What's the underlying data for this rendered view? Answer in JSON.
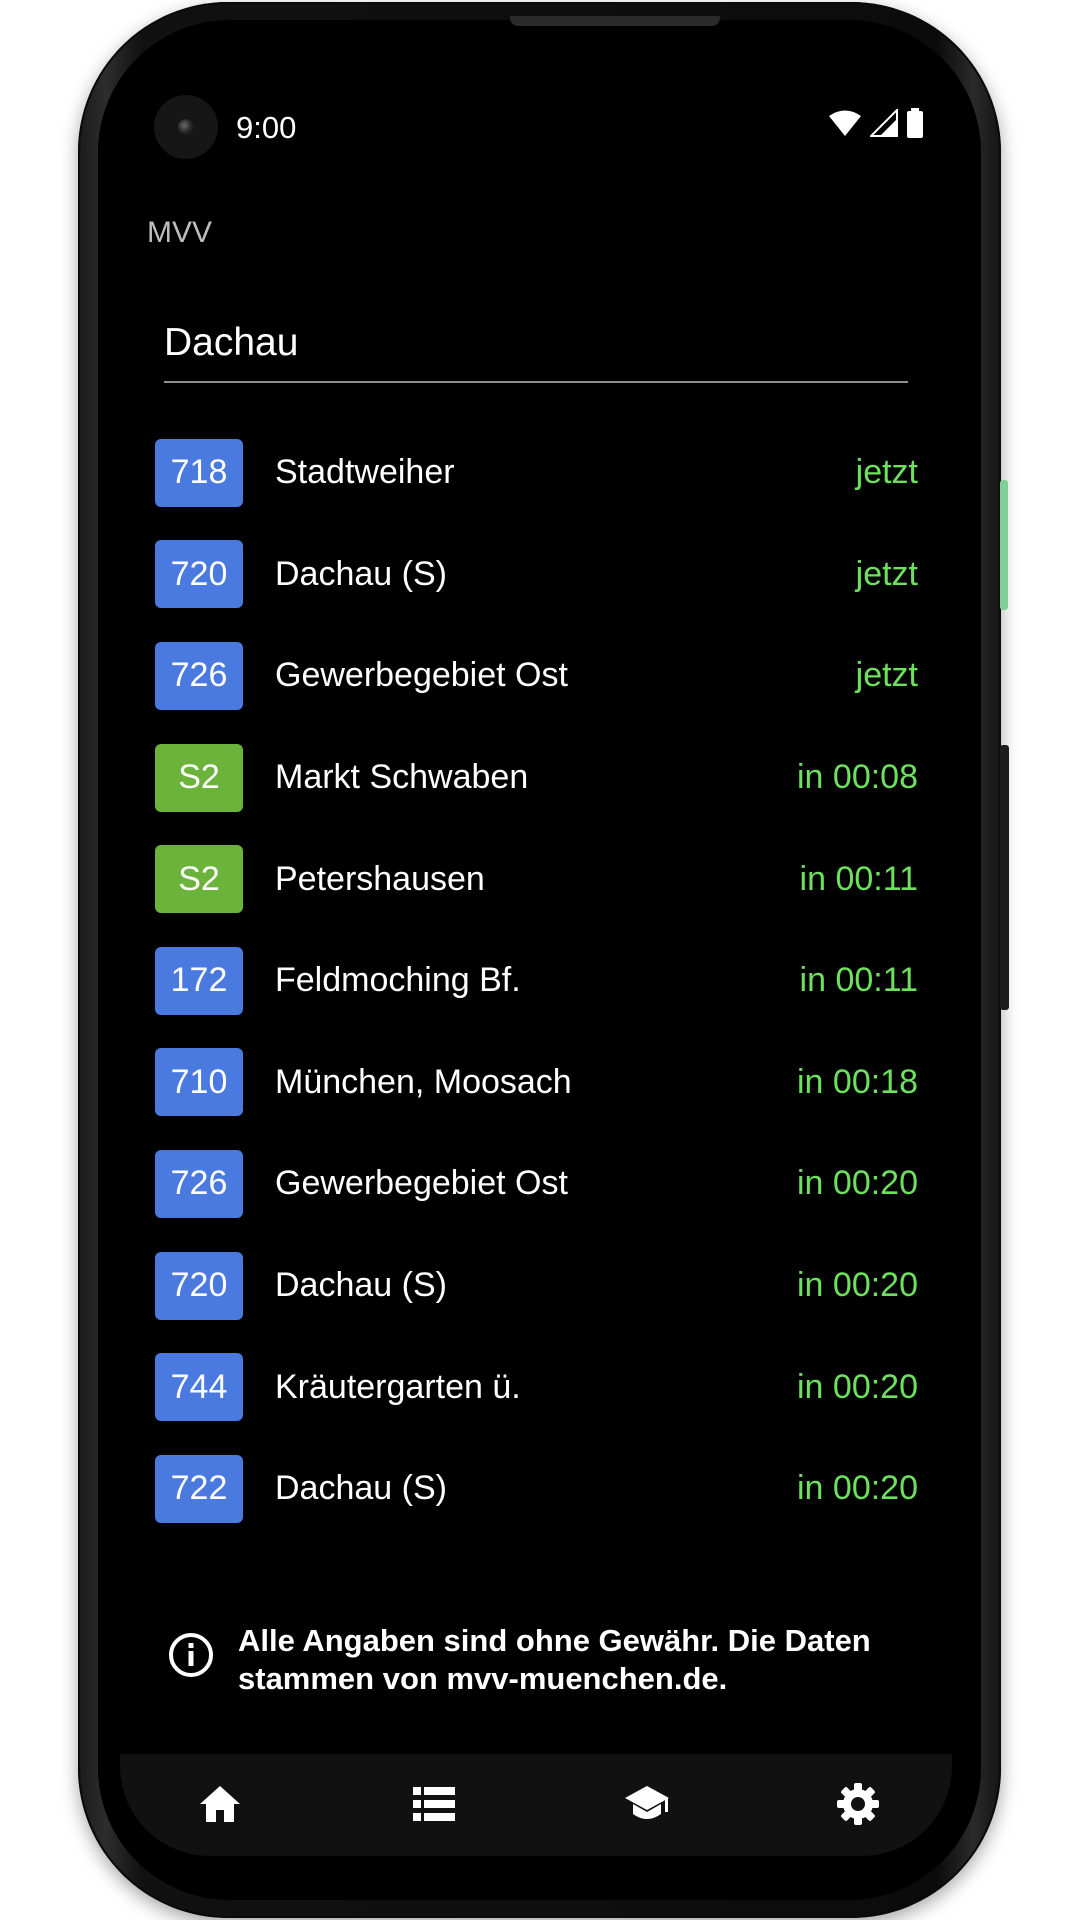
{
  "status_bar": {
    "time": "9:00",
    "icons": [
      "wifi-icon",
      "cellular-signal-icon",
      "battery-icon"
    ]
  },
  "app": {
    "title": "MVV"
  },
  "search": {
    "value": "Dachau"
  },
  "departures": [
    {
      "line": "718",
      "type": "bus",
      "destination": "Stadtweiher",
      "time": "jetzt"
    },
    {
      "line": "720",
      "type": "bus",
      "destination": "Dachau (S)",
      "time": "jetzt"
    },
    {
      "line": "726",
      "type": "bus",
      "destination": "Gewerbegebiet Ost",
      "time": "jetzt"
    },
    {
      "line": "S2",
      "type": "sbahn",
      "destination": "Markt Schwaben",
      "time": "in 00:08"
    },
    {
      "line": "S2",
      "type": "sbahn",
      "destination": "Petershausen",
      "time": "in 00:11"
    },
    {
      "line": "172",
      "type": "bus",
      "destination": "Feldmoching Bf.",
      "time": "in 00:11"
    },
    {
      "line": "710",
      "type": "bus",
      "destination": "München, Moosach",
      "time": "in 00:18"
    },
    {
      "line": "726",
      "type": "bus",
      "destination": "Gewerbegebiet Ost",
      "time": "in 00:20"
    },
    {
      "line": "720",
      "type": "bus",
      "destination": "Dachau (S)",
      "time": "in 00:20"
    },
    {
      "line": "744",
      "type": "bus",
      "destination": "Kräutergarten ü.",
      "time": "in 00:20"
    },
    {
      "line": "722",
      "type": "bus",
      "destination": "Dachau (S)",
      "time": "in 00:20"
    }
  ],
  "disclaimer": {
    "line1": "Alle Angaben sind ohne Gewähr. Die Daten",
    "line2": "stammen von mvv-muenchen.de.",
    "icon": "info-icon"
  },
  "bottom_nav": {
    "items": [
      "home-icon",
      "list-icon",
      "school-icon",
      "settings-icon"
    ]
  },
  "colors": {
    "bus": "#4a7ae0",
    "sbahn": "#6cb33c",
    "time_text": "#6de05d",
    "background": "#000000",
    "nav_background": "#111111"
  }
}
